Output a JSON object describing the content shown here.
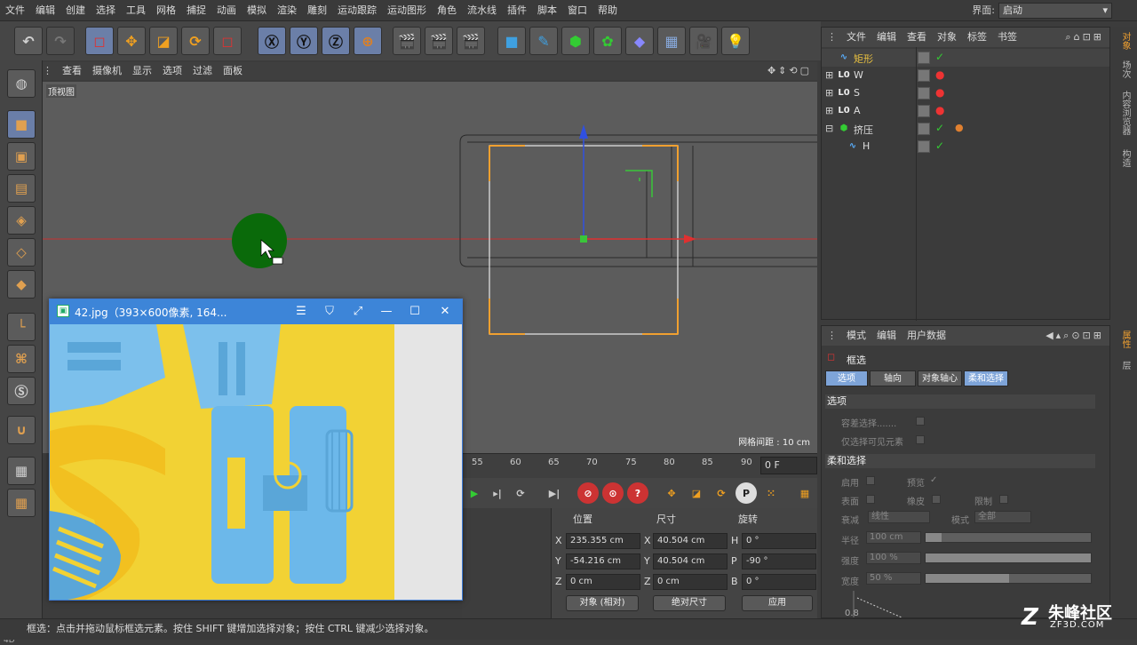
{
  "menubar": {
    "items": [
      "文件",
      "编辑",
      "创建",
      "选择",
      "工具",
      "网格",
      "捕捉",
      "动画",
      "模拟",
      "渲染",
      "雕刻",
      "运动跟踪",
      "运动图形",
      "角色",
      "流水线",
      "插件",
      "脚本",
      "窗口",
      "帮助"
    ],
    "layout_label": "界面:",
    "layout_value": "启动"
  },
  "viewport": {
    "menu": [
      "查看",
      "摄像机",
      "显示",
      "选项",
      "过滤",
      "面板"
    ],
    "title": "顶视图",
    "grid_spacing": "网格间距 : 10 cm"
  },
  "timeline": {
    "ticks": [
      "55",
      "60",
      "65",
      "70",
      "75",
      "80",
      "85",
      "90"
    ],
    "frame": "0 F"
  },
  "coords": {
    "headers": [
      "位置",
      "尺寸",
      "旋转"
    ],
    "rows": [
      {
        "axis": "X",
        "pos": "235.355 cm",
        "size": "40.504 cm",
        "rot_label": "H",
        "rot": "0 °"
      },
      {
        "axis": "Y",
        "pos": "-54.216 cm",
        "size": "40.504 cm",
        "rot_label": "P",
        "rot": "-90 °"
      },
      {
        "axis": "Z",
        "pos": "0 cm",
        "size": "0 cm",
        "rot_label": "B",
        "rot": "0 °"
      }
    ],
    "mode1": "对象 (相对)",
    "mode2": "绝对尺寸",
    "apply": "应用"
  },
  "objects": {
    "menu": [
      "文件",
      "编辑",
      "查看",
      "对象",
      "标签",
      "书签"
    ],
    "items": [
      {
        "name": "矩形",
        "color": "#e8c040"
      },
      {
        "name": "W",
        "color": "#dddddd"
      },
      {
        "name": "S",
        "color": "#dddddd"
      },
      {
        "name": "A",
        "color": "#dddddd"
      },
      {
        "name": "挤压",
        "color": "#dddddd"
      },
      {
        "name": "H",
        "color": "#dddddd"
      }
    ]
  },
  "attributes": {
    "menu": [
      "模式",
      "编辑",
      "用户数据"
    ],
    "tool_name": "框选",
    "tabs": [
      "选项",
      "轴向",
      "对象轴心",
      "柔和选择"
    ],
    "section1": "选项",
    "tolerant": "容差选择.......",
    "visible_only": "仅选择可见元素",
    "section2": "柔和选择",
    "enable": "启用",
    "preview": "预览",
    "surface": "表面",
    "rubber": "橡皮",
    "limit": "限制",
    "falloff": "衰减",
    "falloff_value": "线性",
    "mode": "模式",
    "mode_value": "全部",
    "radius": "半径",
    "radius_value": "100 cm",
    "strength": "强度",
    "strength_value": "100 %",
    "width": "宽度",
    "width_value": "50 %",
    "graph_value": "0.8"
  },
  "right_tabs": [
    "对象",
    "场次",
    "内容浏览器",
    "构造",
    "属性",
    "层"
  ],
  "image_window": {
    "title": "42.jpg（393×600像素, 164..."
  },
  "status": "框选：点击并拖动鼠标框选元素。按住 SHIFT 键增加选择对象；按住 CTRL 键减少选择对象。",
  "watermark": {
    "brand": "朱峰社区",
    "url": "ZF3D.COM"
  }
}
